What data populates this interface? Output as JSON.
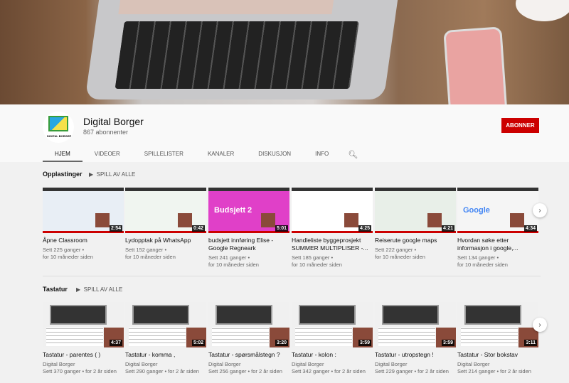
{
  "channel": {
    "name": "Digital Borger",
    "subscribers": "867 abonnenter",
    "subscribe_label": "ABONNER",
    "avatar_text": "DIGITAL BORGER",
    "accent": "#cc0000"
  },
  "tabs": [
    {
      "label": "HJEM"
    },
    {
      "label": "VIDEOER"
    },
    {
      "label": "SPILLELISTER"
    },
    {
      "label": "KANALER"
    },
    {
      "label": "DISKUSJON"
    },
    {
      "label": "INFO"
    }
  ],
  "shelves": [
    {
      "title": "Opplastinger",
      "play_all": "SPILL AV ALLE",
      "videos": [
        {
          "title": "Åpne Classroom",
          "views": "Sett 225 ganger •",
          "age": "for 10 måneder siden",
          "duration": "2:54"
        },
        {
          "title": "Lydopptak på WhatsApp",
          "views": "Sett 152 ganger •",
          "age": "for 10 måneder siden",
          "duration": "0:42"
        },
        {
          "title": "budsjett innføring Elise - Google Regneark",
          "views": "Sett 241 ganger •",
          "age": "for 10 måneder siden",
          "duration": "5:01",
          "thumb_text": "Budsjett 2"
        },
        {
          "title": "Handleliste byggeprosjekt SUMMER MULTIPLISER -...",
          "views": "Sett 185 ganger •",
          "age": "for 10 måneder siden",
          "duration": "4:25"
        },
        {
          "title": "Reiserute google maps",
          "views": "Sett 222 ganger •",
          "age": "for 10 måneder siden",
          "duration": "4:21"
        },
        {
          "title": "Hvordan søke etter informasjon i google,...",
          "views": "Sett 134 ganger •",
          "age": "for 10 måneder siden",
          "duration": "4:34",
          "thumb_text": "Google"
        }
      ]
    },
    {
      "title": "Tastatur",
      "play_all": "SPILL AV ALLE",
      "videos": [
        {
          "title": "Tastatur - parentes ( )",
          "channel": "Digital Borger",
          "meta": "Sett 370 ganger • for 2 år siden",
          "duration": "4:37"
        },
        {
          "title": "Tastatur - komma ,",
          "channel": "Digital Borger",
          "meta": "Sett 290 ganger • for 2 år siden",
          "duration": "5:02"
        },
        {
          "title": "Tastatur - spørsmålstegn ?",
          "channel": "Digital Borger",
          "meta": "Sett 256 ganger • for 2 år siden",
          "duration": "3:20"
        },
        {
          "title": "Tastatur - kolon :",
          "channel": "Digital Borger",
          "meta": "Sett 342 ganger • for 2 år siden",
          "duration": "3:59"
        },
        {
          "title": "Tastatur - utropstegn !",
          "channel": "Digital Borger",
          "meta": "Sett 229 ganger • for 2 år siden",
          "duration": "3:59"
        },
        {
          "title": "Tastatur - Stor bokstav",
          "channel": "Digital Borger",
          "meta": "Sett 214 ganger • for 2 år siden",
          "duration": "3:11"
        }
      ]
    }
  ]
}
